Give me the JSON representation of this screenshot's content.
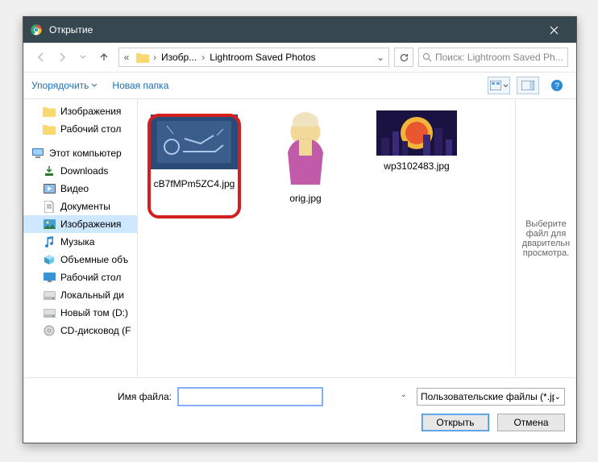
{
  "titlebar": {
    "title": "Открытие"
  },
  "breadcrumb": {
    "part1": "Изобр...",
    "part2": "Lightroom Saved Photos"
  },
  "search": {
    "placeholder": "Поиск: Lightroom Saved Ph..."
  },
  "toolbar": {
    "organize": "Упорядочить",
    "newfolder": "Новая папка"
  },
  "tree": {
    "images": "Изображения",
    "desktop": "Рабочий стол",
    "thispc": "Этот компьютер",
    "downloads": "Downloads",
    "video": "Видео",
    "documents": "Документы",
    "pictures": "Изображения",
    "music": "Музыка",
    "objects3d": "Объемные объ",
    "desktop2": "Рабочий стол",
    "localdisk": "Локальный ди",
    "newvol": "Новый том (D:)",
    "cddrive": "CD-дисковод (F"
  },
  "files": {
    "f1": "cB7fMPm5ZC4.jpg",
    "f2": "orig.jpg",
    "f3": "wp3102483.jpg"
  },
  "preview": "Выберите файл для дварительн просмотра.",
  "footer": {
    "fname_label": "Имя файла:",
    "filter": "Пользовательские файлы (*.jp",
    "open": "Открыть",
    "cancel": "Отмена"
  }
}
